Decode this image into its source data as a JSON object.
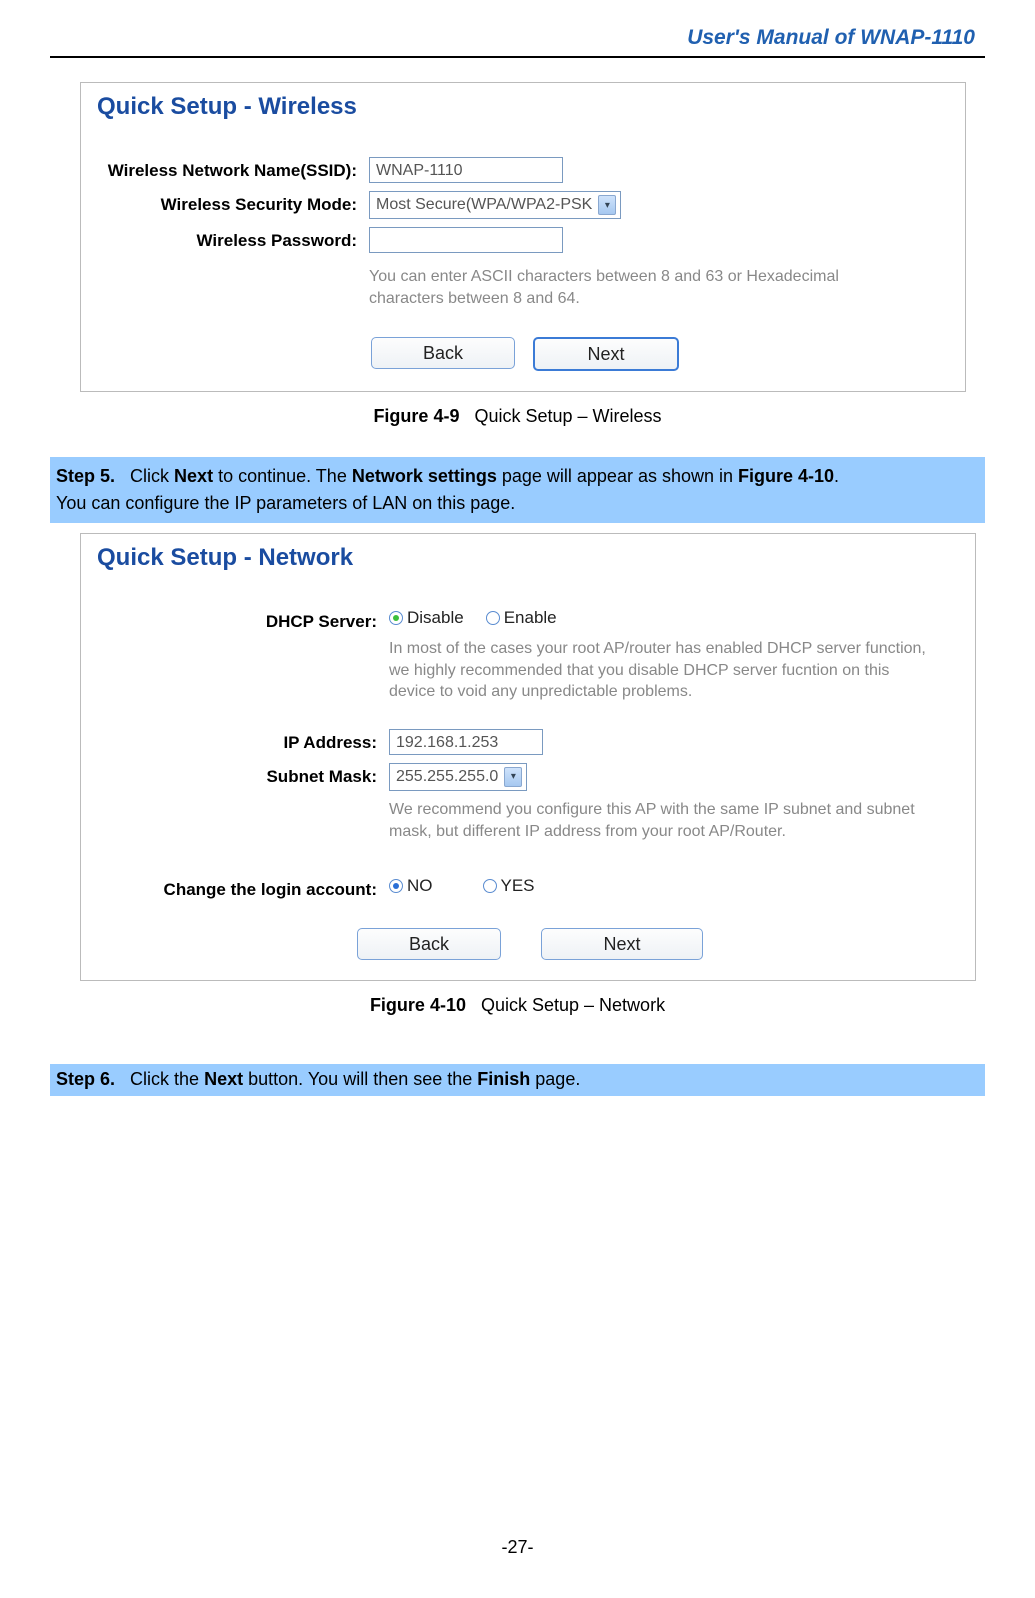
{
  "header": {
    "title": "User's Manual of WNAP-1110"
  },
  "figure1": {
    "title": "Quick Setup - Wireless",
    "ssid_label": "Wireless Network Name(SSID):",
    "ssid_value": "WNAP-1110",
    "secmode_label": "Wireless Security Mode:",
    "secmode_value": "Most Secure(WPA/WPA2-PSK",
    "pass_label": "Wireless Password:",
    "pass_value": "",
    "pass_hint": "You can enter ASCII characters between 8 and 63 or Hexadecimal characters between 8 and 64.",
    "back_btn": "Back",
    "next_btn": "Next",
    "caption_bold": "Figure 4-9",
    "caption_text": "Quick Setup – Wireless"
  },
  "step5": {
    "label": "Step 5.",
    "line1a": "Click ",
    "line1b": "Next",
    "line1c": " to continue. The ",
    "line1d": "Network settings",
    "line1e": " page will appear as shown in ",
    "line1f": "Figure 4-10",
    "line1g": ".",
    "line2": "You can configure the IP parameters of LAN on this page."
  },
  "figure2": {
    "title": "Quick Setup - Network",
    "dhcp_label": "DHCP Server:",
    "dhcp_disable": "Disable",
    "dhcp_enable": "Enable",
    "dhcp_hint": "In most of the cases your root AP/router has enabled DHCP server function, we highly recommended that you disable DHCP server fucntion on this device to void any unpredictable problems.",
    "ip_label": "IP Address:",
    "ip_value": "192.168.1.253",
    "mask_label": "Subnet Mask:",
    "mask_value": "255.255.255.0",
    "ip_hint": "We recommend you configure this AP with the same IP subnet and subnet mask, but different IP address from your root AP/Router.",
    "login_label": "Change the login account:",
    "login_no": "NO",
    "login_yes": "YES",
    "back_btn": "Back",
    "next_btn": "Next",
    "caption_bold": "Figure 4-10",
    "caption_text": "Quick Setup – Network"
  },
  "step6": {
    "label": "Step 6.",
    "a": "Click the ",
    "b": "Next",
    "c": " button. You will then see the ",
    "d": "Finish",
    "e": " page."
  },
  "footer": "-27-"
}
